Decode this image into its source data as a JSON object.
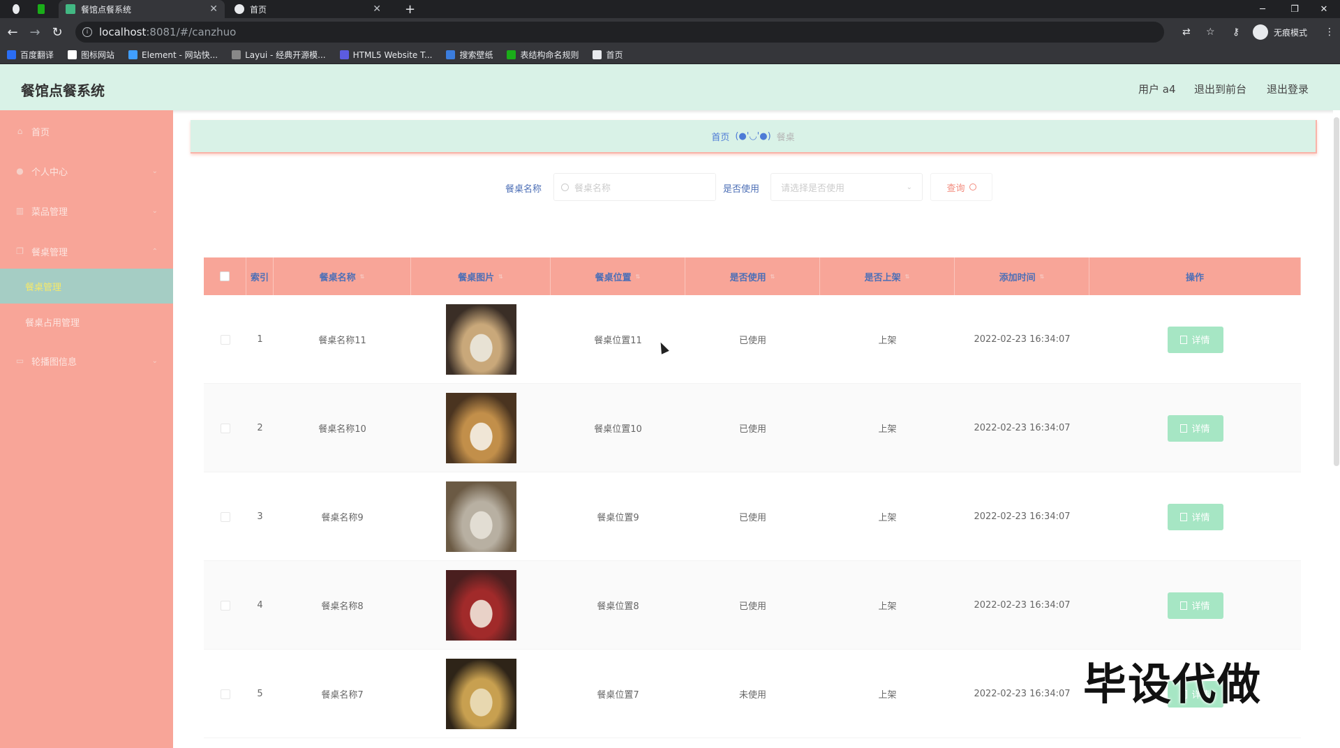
{
  "browser": {
    "tabs": [
      {
        "title": "餐馆点餐系统",
        "active": true
      },
      {
        "title": "首页",
        "active": false
      }
    ],
    "new_tab": "+",
    "url_host": "localhost",
    "url_rest": ":8081/#/canzhuo",
    "incognito_label": "无痕模式",
    "bookmarks": [
      {
        "label": "百度翻译",
        "color": "#2a6df4"
      },
      {
        "label": "图标网站",
        "color": "#ffffff"
      },
      {
        "label": "Element - 网站快...",
        "color": "#409eff"
      },
      {
        "label": "Layui - 经典开源模...",
        "color": "#888888"
      },
      {
        "label": "HTML5 Website T...",
        "color": "#5c5ce0"
      },
      {
        "label": "搜索壁纸",
        "color": "#3b7ddd"
      },
      {
        "label": "表结构命名规则",
        "color": "#1aad19"
      },
      {
        "label": "首页",
        "color": "#e8eaed"
      }
    ]
  },
  "header": {
    "title": "餐馆点餐系统",
    "user": "用户 a4",
    "to_front": "退出到前台",
    "logout": "退出登录"
  },
  "sidebar": {
    "items": [
      {
        "label": "首页",
        "icon": "home-icon",
        "has_children": false
      },
      {
        "label": "个人中心",
        "icon": "user-icon",
        "has_children": true
      },
      {
        "label": "菜品管理",
        "icon": "chart-icon",
        "has_children": true
      },
      {
        "label": "餐桌管理",
        "icon": "copy-icon",
        "has_children": true,
        "expanded": true
      },
      {
        "label": "轮播图信息",
        "icon": "picture-icon",
        "has_children": true
      }
    ],
    "subitems": [
      {
        "label": "餐桌管理",
        "active": true
      },
      {
        "label": "餐桌占用管理",
        "active": false
      }
    ]
  },
  "breadcrumb": {
    "home": "首页",
    "separator": "(●'◡'●)",
    "current": "餐桌"
  },
  "search": {
    "name_label": "餐桌名称",
    "name_placeholder": "餐桌名称",
    "used_label": "是否使用",
    "used_placeholder": "请选择是否使用",
    "query_button": "查询"
  },
  "table": {
    "headers": [
      "索引",
      "餐桌名称",
      "餐桌图片",
      "餐桌位置",
      "是否使用",
      "是否上架",
      "添加时间",
      "操作"
    ],
    "detail_label": "详情",
    "rows": [
      {
        "index": "1",
        "name": "餐桌名称11",
        "location": "餐桌位置11",
        "used": "已使用",
        "shelf": "上架",
        "time": "2022-02-23 16:34:07",
        "img_colors": [
          "#3a2e26",
          "#c9a87a",
          "#e8e2d4"
        ]
      },
      {
        "index": "2",
        "name": "餐桌名称10",
        "location": "餐桌位置10",
        "used": "已使用",
        "shelf": "上架",
        "time": "2022-02-23 16:34:07",
        "img_colors": [
          "#4a3420",
          "#c28f4a",
          "#f0e6d6"
        ]
      },
      {
        "index": "3",
        "name": "餐桌名称9",
        "location": "餐桌位置9",
        "used": "已使用",
        "shelf": "上架",
        "time": "2022-02-23 16:34:07",
        "img_colors": [
          "#6b5a44",
          "#b8b0a2",
          "#e2ddd3"
        ]
      },
      {
        "index": "4",
        "name": "餐桌名称8",
        "location": "餐桌位置8",
        "used": "已使用",
        "shelf": "上架",
        "time": "2022-02-23 16:34:07",
        "img_colors": [
          "#4a1f1f",
          "#a12a2a",
          "#e9d2c8"
        ]
      },
      {
        "index": "5",
        "name": "餐桌名称7",
        "location": "餐桌位置7",
        "used": "未使用",
        "shelf": "上架",
        "time": "2022-02-23 16:34:07",
        "img_colors": [
          "#2e2418",
          "#c8a050",
          "#e8d8b0"
        ]
      }
    ]
  },
  "watermark": "毕设代做"
}
